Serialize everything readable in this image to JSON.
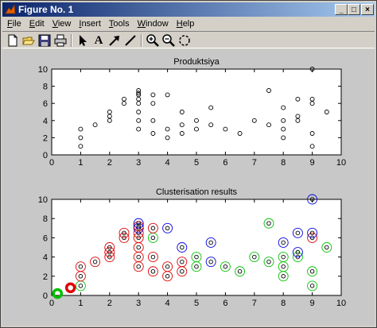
{
  "window": {
    "title": "Figure No. 1",
    "controls": {
      "minimize": "_",
      "maximize": "□",
      "close": "×"
    }
  },
  "menu": [
    {
      "label": "File",
      "key": "F",
      "rest": "ile"
    },
    {
      "label": "Edit",
      "key": "E",
      "rest": "dit"
    },
    {
      "label": "View",
      "key": "V",
      "rest": "iew"
    },
    {
      "label": "Insert",
      "key": "I",
      "rest": "nsert"
    },
    {
      "label": "Tools",
      "key": "T",
      "rest": "ools"
    },
    {
      "label": "Window",
      "key": "W",
      "rest": "indow"
    },
    {
      "label": "Help",
      "key": "H",
      "rest": "elp"
    }
  ],
  "toolbar": {
    "icons": [
      "new-file-icon",
      "open-folder-icon",
      "save-icon",
      "print-icon",
      "pointer-icon",
      "text-tool-icon",
      "arrow-tool-icon",
      "line-tool-icon",
      "zoom-in-icon",
      "zoom-out-icon",
      "rotate-icon"
    ],
    "text_tool_glyph": "A"
  },
  "chart_data": [
    {
      "type": "scatter",
      "title": "Produktsiya",
      "xlim": [
        0,
        10
      ],
      "ylim": [
        0,
        10
      ],
      "xticks": [
        "0",
        "1",
        "2",
        "3",
        "4",
        "5",
        "6",
        "7",
        "8",
        "9",
        "10"
      ],
      "yticks": [
        "0",
        "2",
        "4",
        "6",
        "8",
        "10"
      ],
      "points": [
        [
          1,
          1
        ],
        [
          1,
          2
        ],
        [
          1,
          3
        ],
        [
          1.5,
          3.5
        ],
        [
          2,
          4
        ],
        [
          2,
          4.5
        ],
        [
          2,
          5
        ],
        [
          2.5,
          6
        ],
        [
          2.5,
          6.5
        ],
        [
          3,
          3
        ],
        [
          3,
          4
        ],
        [
          3,
          5
        ],
        [
          3,
          6
        ],
        [
          3,
          6.5
        ],
        [
          3,
          7
        ],
        [
          3,
          7.2
        ],
        [
          3,
          7.5
        ],
        [
          3.5,
          2.5
        ],
        [
          3.5,
          4
        ],
        [
          3.5,
          6
        ],
        [
          3.5,
          7
        ],
        [
          4,
          2
        ],
        [
          4,
          3
        ],
        [
          4,
          7
        ],
        [
          4.5,
          2.5
        ],
        [
          4.5,
          3.5
        ],
        [
          4.5,
          5
        ],
        [
          5,
          3
        ],
        [
          5,
          4
        ],
        [
          5.5,
          3.5
        ],
        [
          5.5,
          5.5
        ],
        [
          6,
          3
        ],
        [
          6.5,
          2.5
        ],
        [
          7,
          4
        ],
        [
          7.5,
          3.5
        ],
        [
          7.5,
          7.5
        ],
        [
          8,
          2
        ],
        [
          8,
          3
        ],
        [
          8,
          4
        ],
        [
          8,
          5.5
        ],
        [
          8.5,
          4
        ],
        [
          8.5,
          4.5
        ],
        [
          8.5,
          6.5
        ],
        [
          9,
          1
        ],
        [
          9,
          2.5
        ],
        [
          9,
          6
        ],
        [
          9,
          6.5
        ],
        [
          9,
          10
        ],
        [
          9.5,
          5
        ]
      ]
    },
    {
      "type": "scatter",
      "title": "Clusterisation results",
      "xlim": [
        0,
        10
      ],
      "ylim": [
        0,
        10
      ],
      "xticks": [
        "0",
        "1",
        "2",
        "3",
        "4",
        "5",
        "6",
        "7",
        "8",
        "9",
        "10"
      ],
      "yticks": [
        "0",
        "2",
        "4",
        "6",
        "8",
        "10"
      ],
      "colors": {
        "red": "#e00000",
        "green": "#00c000",
        "blue": "#0000e0",
        "black": "#000000"
      },
      "centroids": [
        {
          "x": 0.2,
          "y": 0.2,
          "color": "green"
        },
        {
          "x": 0.65,
          "y": 0.8,
          "color": "red"
        }
      ],
      "points": [
        {
          "x": 1,
          "y": 1,
          "color": "green"
        },
        {
          "x": 1,
          "y": 2,
          "color": "red"
        },
        {
          "x": 1,
          "y": 3,
          "color": "red"
        },
        {
          "x": 1.5,
          "y": 3.5,
          "color": "red"
        },
        {
          "x": 2,
          "y": 4,
          "color": "red"
        },
        {
          "x": 2,
          "y": 4.5,
          "color": "red"
        },
        {
          "x": 2,
          "y": 5,
          "color": "red"
        },
        {
          "x": 2.5,
          "y": 6,
          "color": "red"
        },
        {
          "x": 2.5,
          "y": 6.5,
          "color": "red"
        },
        {
          "x": 3,
          "y": 3,
          "color": "red"
        },
        {
          "x": 3,
          "y": 4,
          "color": "red"
        },
        {
          "x": 3,
          "y": 5,
          "color": "red"
        },
        {
          "x": 3,
          "y": 6,
          "color": "red"
        },
        {
          "x": 3,
          "y": 6.5,
          "color": "red"
        },
        {
          "x": 3,
          "y": 7,
          "color": "blue"
        },
        {
          "x": 3,
          "y": 7.2,
          "color": "red"
        },
        {
          "x": 3,
          "y": 7.5,
          "color": "blue"
        },
        {
          "x": 3.5,
          "y": 2.5,
          "color": "red"
        },
        {
          "x": 3.5,
          "y": 4,
          "color": "red"
        },
        {
          "x": 3.5,
          "y": 6,
          "color": "green"
        },
        {
          "x": 3.5,
          "y": 7,
          "color": "red"
        },
        {
          "x": 4,
          "y": 2,
          "color": "red"
        },
        {
          "x": 4,
          "y": 3,
          "color": "red"
        },
        {
          "x": 4,
          "y": 7,
          "color": "blue"
        },
        {
          "x": 4.5,
          "y": 2.5,
          "color": "red"
        },
        {
          "x": 4.5,
          "y": 3.5,
          "color": "red"
        },
        {
          "x": 4.5,
          "y": 5,
          "color": "blue"
        },
        {
          "x": 5,
          "y": 3,
          "color": "green"
        },
        {
          "x": 5,
          "y": 4,
          "color": "green"
        },
        {
          "x": 5.5,
          "y": 3.5,
          "color": "blue"
        },
        {
          "x": 5.5,
          "y": 5.5,
          "color": "blue"
        },
        {
          "x": 6,
          "y": 3,
          "color": "green"
        },
        {
          "x": 6.5,
          "y": 2.5,
          "color": "green"
        },
        {
          "x": 7,
          "y": 4,
          "color": "green"
        },
        {
          "x": 7.5,
          "y": 3.5,
          "color": "green"
        },
        {
          "x": 7.5,
          "y": 7.5,
          "color": "green"
        },
        {
          "x": 8,
          "y": 2,
          "color": "green"
        },
        {
          "x": 8,
          "y": 3,
          "color": "green"
        },
        {
          "x": 8,
          "y": 4,
          "color": "green"
        },
        {
          "x": 8,
          "y": 5.5,
          "color": "blue"
        },
        {
          "x": 8.5,
          "y": 4,
          "color": "green"
        },
        {
          "x": 8.5,
          "y": 4.5,
          "color": "blue"
        },
        {
          "x": 8.5,
          "y": 6.5,
          "color": "blue"
        },
        {
          "x": 9,
          "y": 1,
          "color": "green"
        },
        {
          "x": 9,
          "y": 2.5,
          "color": "green"
        },
        {
          "x": 9,
          "y": 6,
          "color": "red"
        },
        {
          "x": 9,
          "y": 6.5,
          "color": "blue"
        },
        {
          "x": 9,
          "y": 10,
          "color": "blue"
        },
        {
          "x": 9.5,
          "y": 5,
          "color": "green"
        }
      ]
    }
  ]
}
